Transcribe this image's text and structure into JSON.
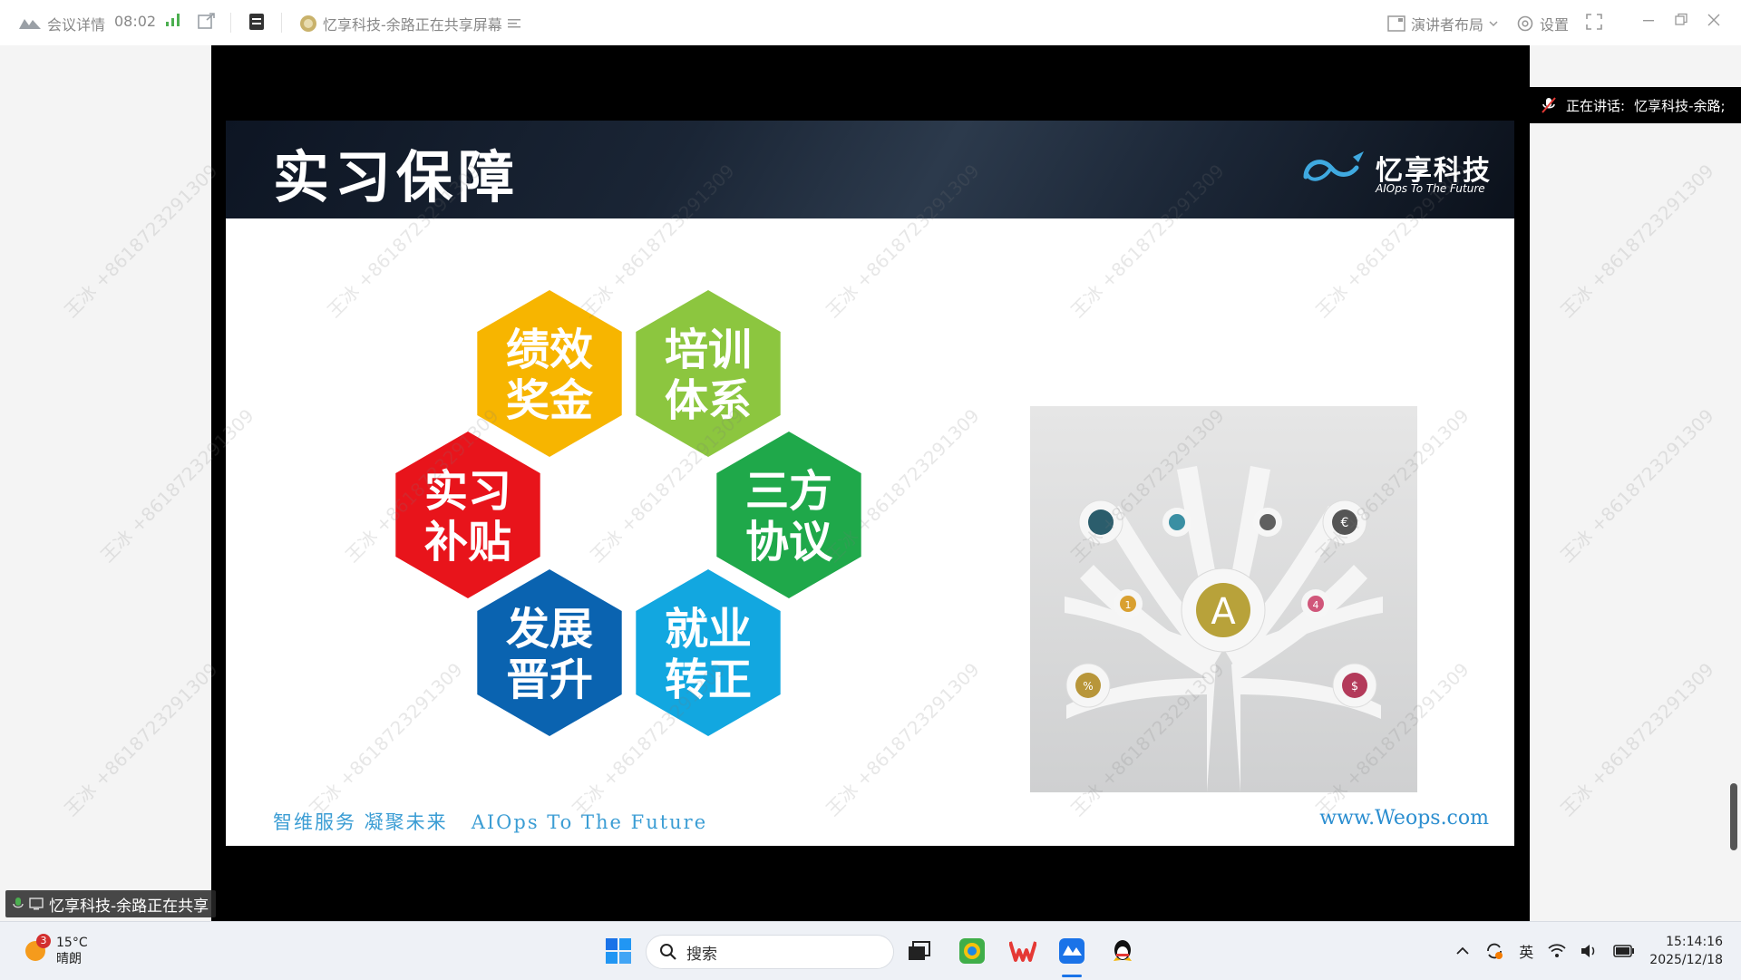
{
  "topbar": {
    "meeting_details": "会议详情",
    "elapsed": "08:02",
    "sharing_title": "忆享科技-余路正在共享屏幕",
    "layout_label": "演讲者布局",
    "settings_label": "设置"
  },
  "slide": {
    "title": "实习保障",
    "logo_cn": "忆享科技",
    "logo_en": "AIOps To The Future",
    "hexagons": [
      {
        "line1": "绩效",
        "line2": "奖金",
        "color": "#f7b500"
      },
      {
        "line1": "培训",
        "line2": "体系",
        "color": "#8cc63f"
      },
      {
        "line1": "实习",
        "line2": "补贴",
        "color": "#e8141b"
      },
      {
        "line1": "三方",
        "line2": "协议",
        "color": "#1fa84a"
      },
      {
        "line1": "发展",
        "line2": "晋升",
        "color": "#0a63b0"
      },
      {
        "line1": "就业",
        "line2": "转正",
        "color": "#12a7e0"
      }
    ],
    "tree_center": "A",
    "tree_nodes": [
      "1",
      "4",
      "%",
      "$",
      "€"
    ],
    "footer_cn": "智维服务 凝聚未来",
    "footer_en": "AIOps To The Future",
    "footer_url": "www.Weops.com"
  },
  "speaker": {
    "prefix": "正在讲话:",
    "name": "忆享科技-余路;"
  },
  "share_label": "忆享科技-余路正在共享",
  "watermark": "王冰 +8618723291309",
  "taskbar": {
    "weather_temp": "15°C",
    "weather_desc": "晴朗",
    "weather_badge": "3",
    "search_placeholder": "搜索",
    "ime": "英",
    "time": "15:14:16",
    "date": "2025/12/18"
  }
}
